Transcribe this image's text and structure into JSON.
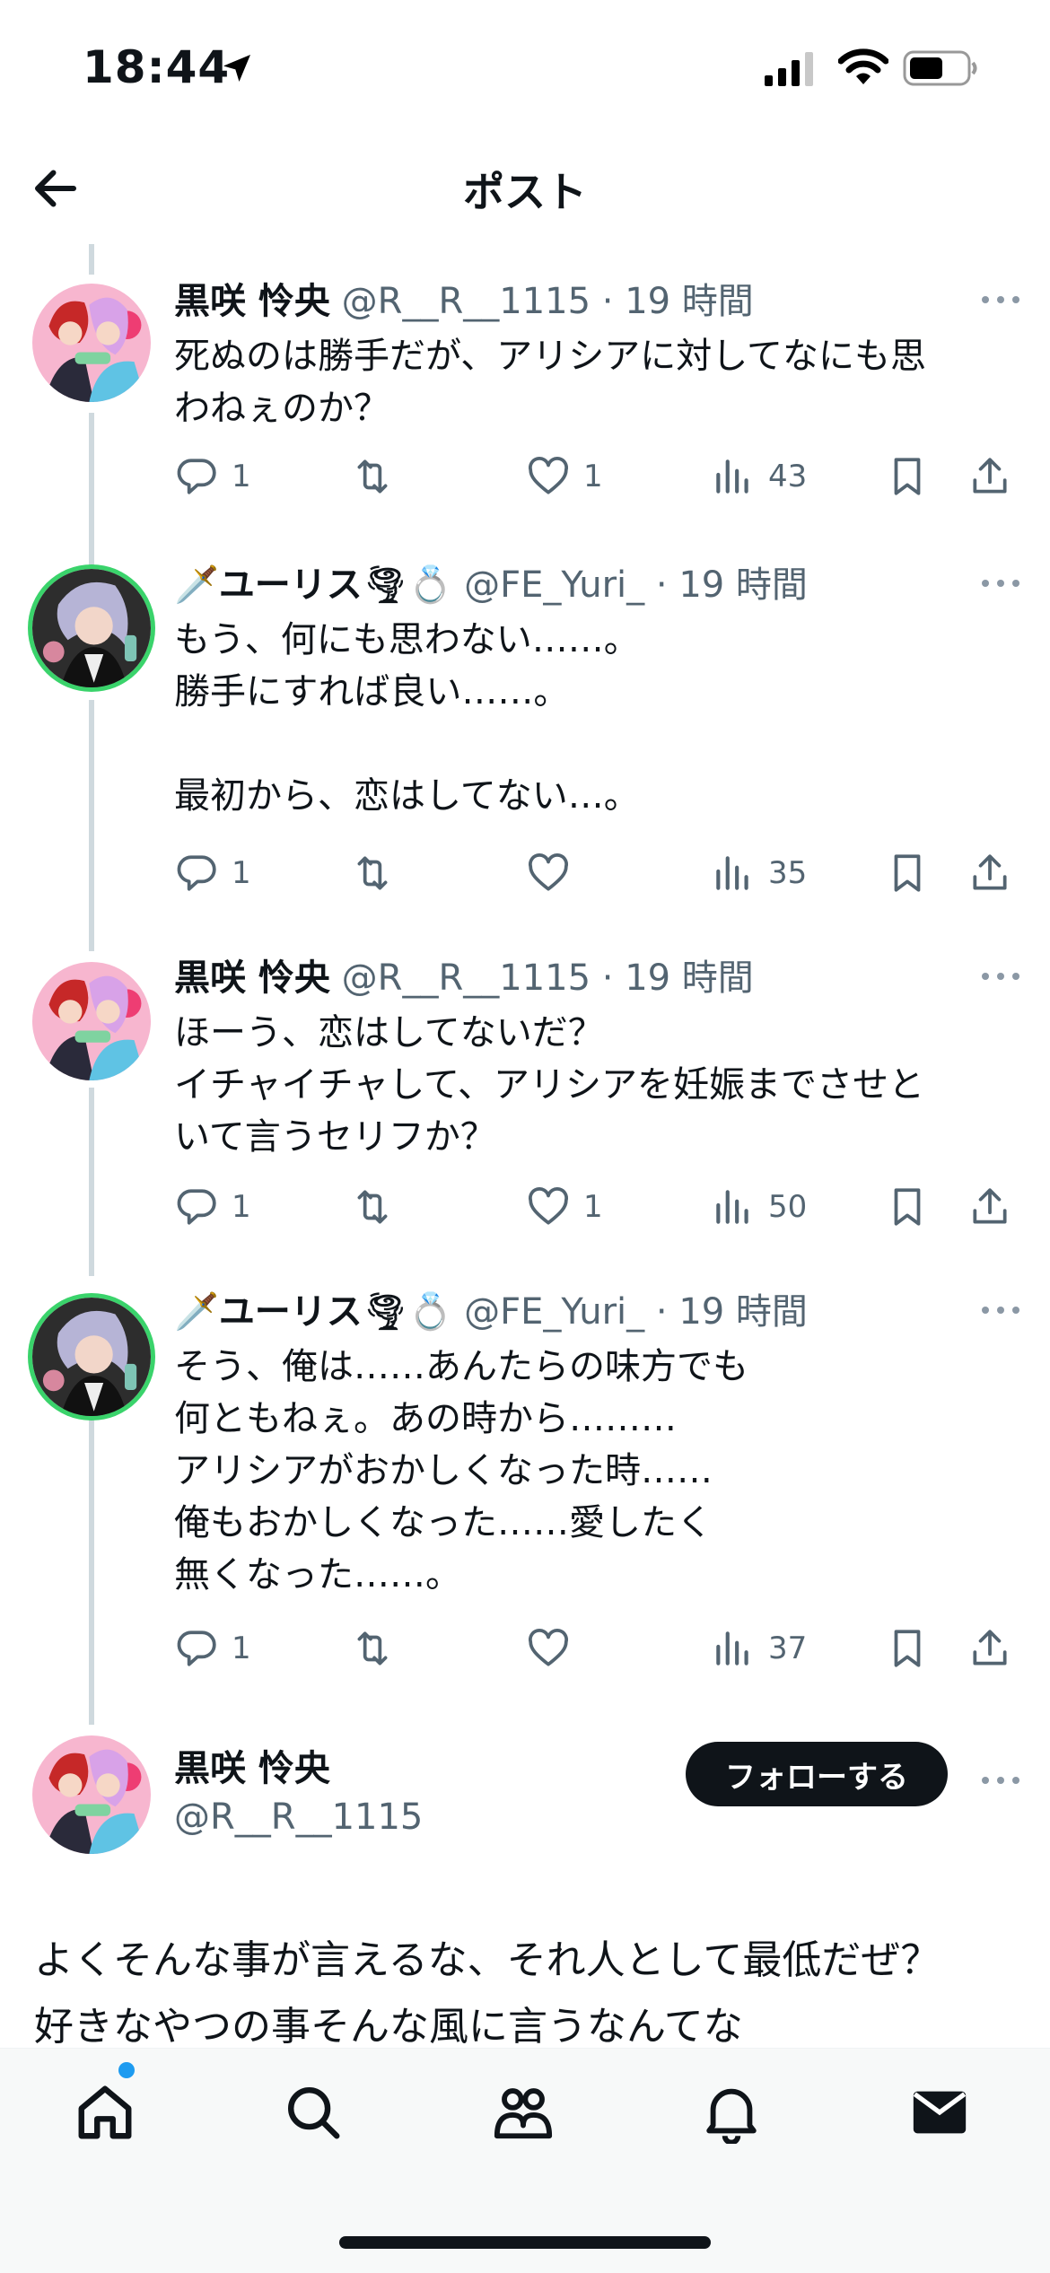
{
  "status_bar": {
    "time": "18:44"
  },
  "header": {
    "title": "ポスト"
  },
  "tweets": [
    {
      "name": "黒咲 怜央",
      "handle": "@R__R__1115",
      "time": "· 19 時間",
      "text": "死ぬのは勝手だが、アリシアに対してなにも思\nわねぇのか？",
      "replies": "1",
      "retweets": "",
      "likes": "1",
      "views": "43"
    },
    {
      "name": "ユーリス",
      "name_prefix_emoji": "🗡️",
      "name_suffix_emoji": "🌪💍",
      "handle": "@FE_Yuri_",
      "time": "· 19 時間",
      "text": "もう、何にも思わない……。\n勝手にすれば良い……。\n\n最初から、恋はしてない…。",
      "replies": "1",
      "retweets": "",
      "likes": "",
      "views": "35"
    },
    {
      "name": "黒咲 怜央",
      "handle": "@R__R__1115",
      "time": "· 19 時間",
      "text": "ほーう、恋はしてないだ？\nイチャイチャして、アリシアを妊娠までさせと\nいて言うセリフか？",
      "replies": "1",
      "retweets": "",
      "likes": "1",
      "views": "50"
    },
    {
      "name": "ユーリス",
      "name_prefix_emoji": "🗡️",
      "name_suffix_emoji": "🌪💍",
      "handle": "@FE_Yuri_",
      "time": "· 19 時間",
      "text": "そう、俺は……あんたらの味方でも\n何ともねぇ。あの時から………\nアリシアがおかしくなった時……\n俺もおかしくなった……愛したく\n無くなった……。",
      "replies": "1",
      "retweets": "",
      "likes": "",
      "views": "37"
    }
  ],
  "main_post": {
    "name": "黒咲 怜央",
    "handle": "@R__R__1115",
    "follow_label": "フォローする",
    "text": "よくそんな事が言えるな、それ人として最低だぜ？\n好きなやつの事そんな風に言うなんてな"
  },
  "tabbar": {
    "items": [
      "home-icon",
      "search-icon",
      "communities-icon",
      "notifications-icon",
      "messages-icon"
    ]
  },
  "colors": {
    "accent": "#1d9bf0",
    "text": "#0f1419",
    "secondary": "#536471",
    "follow_bg": "#0f1419"
  }
}
